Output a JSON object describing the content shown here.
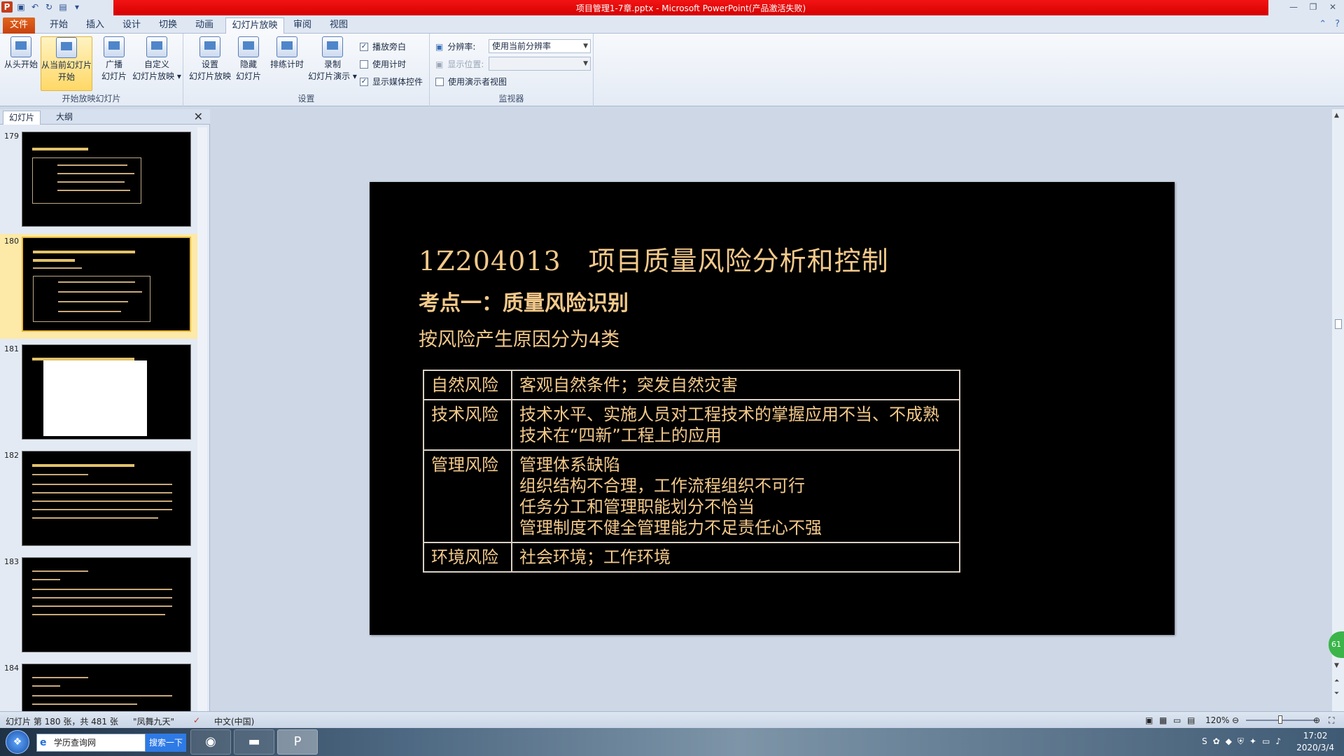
{
  "window": {
    "title": "项目管理1-7章.pptx - Microsoft PowerPoint(产品激活失败)",
    "app_icon": "P"
  },
  "tabs": [
    "文件",
    "开始",
    "插入",
    "设计",
    "切换",
    "动画",
    "幻灯片放映",
    "审阅",
    "视图"
  ],
  "active_tab": "幻灯片放映",
  "ribbon": {
    "group_start": {
      "label": "开始放映幻灯片",
      "from_beginning": "从头开始",
      "from_current_1": "从当前幻灯片",
      "from_current_2": "开始",
      "broadcast_1": "广播",
      "broadcast_2": "幻灯片",
      "custom_1": "自定义",
      "custom_2": "幻灯片放映 ▾"
    },
    "group_setup": {
      "label": "设置",
      "setup_1": "设置",
      "setup_2": "幻灯片放映",
      "hide_1": "隐藏",
      "hide_2": "幻灯片",
      "rehearse": "排练计时",
      "record_1": "录制",
      "record_2": "幻灯片演示 ▾",
      "play_narrations": "播放旁白",
      "use_timings": "使用计时",
      "show_media": "显示媒体控件"
    },
    "group_monitors": {
      "label": "监视器",
      "resolution_label": "分辨率:",
      "resolution_value": "使用当前分辨率",
      "show_on_label": "显示位置:",
      "show_on_value": "",
      "presenter_view": "使用演示者视图"
    }
  },
  "left_panel": {
    "tab_slides": "幻灯片",
    "tab_outline": "大纲",
    "thumbnails": [
      {
        "num": "179"
      },
      {
        "num": "180"
      },
      {
        "num": "181"
      },
      {
        "num": "182"
      },
      {
        "num": "183"
      },
      {
        "num": "184"
      }
    ]
  },
  "slide": {
    "title": "1Z204013　项目质量风险分析和控制",
    "subtitle": "考点一：质量风险识别",
    "intro": "按风险产生原因分为4类",
    "table": [
      {
        "category": "自然风险",
        "lines": [
          "客观自然条件；突发自然灾害"
        ]
      },
      {
        "category": "技术风险",
        "lines": [
          "技术水平、实施人员对工程技术的掌握应用不当、不成熟技术在“四新”工程上的应用"
        ]
      },
      {
        "category": "管理风险",
        "lines": [
          "管理体系缺陷",
          "组织结构不合理，工作流程组织不可行",
          "任务分工和管理职能划分不恰当",
          "管理制度不健全管理能力不足责任心不强"
        ]
      },
      {
        "category": "环境风险",
        "lines": [
          "社会环境；工作环境"
        ]
      }
    ]
  },
  "badge": "61",
  "statusbar": {
    "slide_info": "幻灯片 第 180 张，共 481 张",
    "theme": "\"凤舞九天\"",
    "language": "中文(中国)",
    "zoom": "120%"
  },
  "taskbar": {
    "search_text": "学历查询网",
    "search_button": "搜索一下",
    "time": "17:02",
    "date": "2020/3/4"
  }
}
